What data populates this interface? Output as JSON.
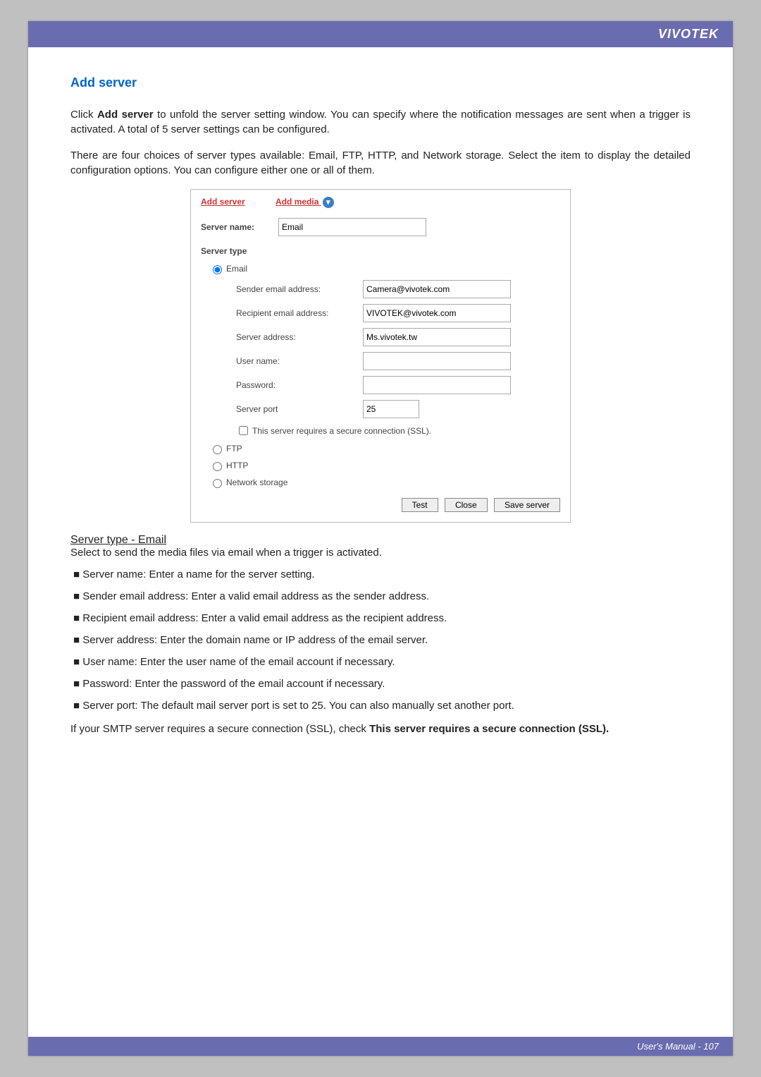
{
  "header": {
    "brand": "VIVOTEK"
  },
  "section": {
    "title": "Add server"
  },
  "intro": {
    "p1_pre": "Click ",
    "p1_bold": "Add server",
    "p1_post": " to unfold the server setting window. You can specify where the notification messages are sent when a trigger is activated. A total of 5 server settings can be configured.",
    "p2": "There are four choices of server types available: Email, FTP, HTTP, and Network storage. Select the item to display the detailed configuration options. You can configure either one or all of them."
  },
  "panel": {
    "tabs": {
      "add_server": "Add server",
      "add_media": "Add media"
    },
    "server_name_label": "Server name:",
    "server_name_value": "Email",
    "server_type_label": "Server type",
    "options": {
      "email": "Email",
      "ftp": "FTP",
      "http": "HTTP",
      "network_storage": "Network storage"
    },
    "email_fields": {
      "sender_label": "Sender email address:",
      "sender_value": "Camera@vivotek.com",
      "recipient_label": "Recipient email address:",
      "recipient_value": "VIVOTEK@vivotek.com",
      "server_addr_label": "Server address:",
      "server_addr_value": "Ms.vivotek.tw",
      "username_label": "User name:",
      "username_value": "",
      "password_label": "Password:",
      "password_value": "",
      "port_label": "Server port",
      "port_value": "25",
      "ssl_label": "This server requires a secure connection (SSL)."
    },
    "buttons": {
      "test": "Test",
      "close": "Close",
      "save": "Save server"
    }
  },
  "explain": {
    "heading": "Server type - Email",
    "sub": "Select to send the media files via email when a trigger is activated.",
    "bullets": [
      "Server name: Enter a name for the server setting.",
      "Sender email address: Enter a valid email address as the sender address.",
      "Recipient email address: Enter a valid email address as the recipient address.",
      "Server address: Enter the domain name or IP address of the email server.",
      "User name: Enter the user name of the email account if necessary.",
      "Password: Enter the password of the email account if necessary.",
      "Server port: The default mail server port is set to 25. You can also manually set another port."
    ],
    "ssl_pre": "If your SMTP server requires a secure connection (SSL), check ",
    "ssl_bold": "This server requires a secure connection (SSL)."
  },
  "footer": {
    "text": "User's Manual - 107"
  }
}
